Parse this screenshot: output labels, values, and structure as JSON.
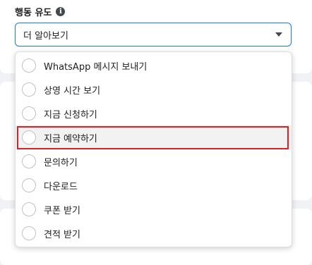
{
  "field": {
    "label": "행동 유도",
    "info_icon": "info-icon",
    "selected_value": "더 알아보기"
  },
  "dropdown": {
    "options": [
      {
        "label": "WhatsApp 메시지 보내기"
      },
      {
        "label": "상영 시간 보기"
      },
      {
        "label": "지금 신청하기"
      },
      {
        "label": "지금 예약하기",
        "highlighted": true
      },
      {
        "label": "문의하기"
      },
      {
        "label": "다운로드"
      },
      {
        "label": "쿠폰 받기"
      },
      {
        "label": "견적 받기"
      }
    ]
  },
  "colors": {
    "accent": "#1877f2",
    "highlight_border": "#e02020",
    "background": "#f0f2f5"
  }
}
